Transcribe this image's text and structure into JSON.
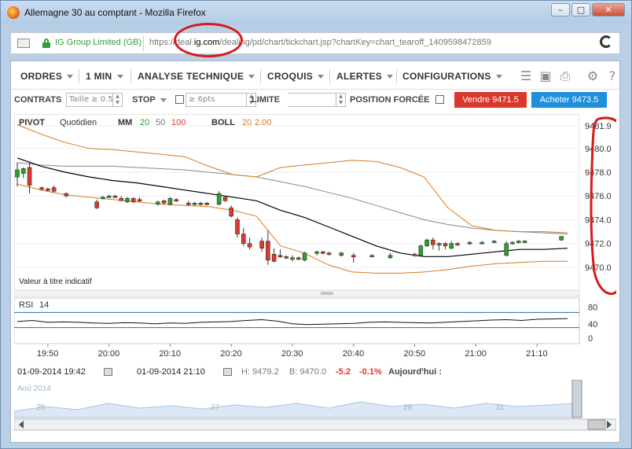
{
  "window": {
    "title": "Allemagne 30 au comptant - Mozilla Firefox",
    "buttons": [
      "–",
      "□",
      "✕"
    ]
  },
  "urlbar": {
    "site_identity": "IG Group Limited (GB)",
    "url_prefix": "https://deal.",
    "url_domain": "ig.com",
    "url_rest": "/dealing/pd/chart/tickchart.jsp?chartKey=chart_tearoff_1409598472859"
  },
  "menu": {
    "ordres": "ORDRES",
    "interval": "1 MIN",
    "analyse": "ANALYSE TECHNIQUE",
    "croquis": "CROQUIS",
    "alertes": "ALERTES",
    "configurations": "CONFIGURATIONS",
    "icons": [
      "layers-icon",
      "image-icon",
      "print-icon",
      "gear-icon",
      "help-icon"
    ]
  },
  "order": {
    "contrats_label": "CONTRATS",
    "contrats_placeholder": "Taille ≥ 0.5",
    "stop_label": "STOP",
    "stop_placeholder": "≥ 6pts",
    "limite_label": "LIMITE",
    "forcee_label": "POSITION FORCÉE",
    "sell": "Vendre 9471.5",
    "buy": "Acheter 9473.5"
  },
  "chart_data": {
    "type": "candlestick",
    "legend": {
      "pivot": "PIVOT",
      "pivot_period": "Quotidien",
      "mm": "MM",
      "mm_periods": [
        "20",
        "50",
        "100"
      ],
      "boll": "BOLL",
      "boll_params": [
        "20",
        "2.00"
      ]
    },
    "note": "Valeur à titre indicatif",
    "y_ticks": [
      "9481.9",
      "9480.0",
      "9478.0",
      "9476.0",
      "9474.0",
      "9472.0",
      "9470.0"
    ],
    "ylim": [
      9469.0,
      9482.5
    ],
    "x_ticks": [
      "19:50",
      "20:00",
      "20:10",
      "20:20",
      "20:30",
      "20:40",
      "20:50",
      "21:00",
      "21:10"
    ],
    "candles": [
      {
        "t": 0,
        "o": 9477.6,
        "h": 9478.8,
        "l": 9476.8,
        "c": 9478.2
      },
      {
        "t": 1,
        "o": 9477.9,
        "h": 9478.4,
        "l": 9477.5,
        "c": 9478.3
      },
      {
        "t": 2,
        "o": 9478.4,
        "h": 9478.9,
        "l": 9476.2,
        "c": 9476.9
      },
      {
        "t": 4,
        "o": 9476.7,
        "h": 9476.8,
        "l": 9476.5,
        "c": 9476.6
      },
      {
        "t": 5,
        "o": 9476.6,
        "h": 9476.7,
        "l": 9476.4,
        "c": 9476.5
      },
      {
        "t": 6,
        "o": 9476.7,
        "h": 9476.9,
        "l": 9476.3,
        "c": 9476.4
      },
      {
        "t": 8,
        "o": 9476.2,
        "h": 9476.3,
        "l": 9475.9,
        "c": 9476.0
      },
      {
        "t": 13,
        "o": 9475.5,
        "h": 9475.7,
        "l": 9474.9,
        "c": 9475.0
      },
      {
        "t": 14,
        "o": 9475.8,
        "h": 9476.0,
        "l": 9475.7,
        "c": 9475.9
      },
      {
        "t": 15,
        "o": 9476.0,
        "h": 9476.1,
        "l": 9475.9,
        "c": 9476.0
      },
      {
        "t": 16,
        "o": 9476.0,
        "h": 9476.1,
        "l": 9475.9,
        "c": 9475.9
      },
      {
        "t": 17,
        "o": 9475.8,
        "h": 9476.0,
        "l": 9475.6,
        "c": 9475.6
      },
      {
        "t": 18,
        "o": 9475.5,
        "h": 9475.9,
        "l": 9475.4,
        "c": 9475.8
      },
      {
        "t": 19,
        "o": 9475.8,
        "h": 9475.9,
        "l": 9475.4,
        "c": 9475.5
      },
      {
        "t": 20,
        "o": 9475.7,
        "h": 9475.9,
        "l": 9475.5,
        "c": 9475.6
      },
      {
        "t": 23,
        "o": 9475.3,
        "h": 9475.6,
        "l": 9475.2,
        "c": 9475.5
      },
      {
        "t": 24,
        "o": 9475.6,
        "h": 9475.7,
        "l": 9475.3,
        "c": 9475.4
      },
      {
        "t": 25,
        "o": 9475.3,
        "h": 9475.9,
        "l": 9475.2,
        "c": 9475.8
      },
      {
        "t": 26,
        "o": 9475.7,
        "h": 9475.8,
        "l": 9475.5,
        "c": 9475.6
      },
      {
        "t": 28,
        "o": 9475.4,
        "h": 9475.6,
        "l": 9475.2,
        "c": 9475.3
      },
      {
        "t": 29,
        "o": 9475.3,
        "h": 9475.5,
        "l": 9475.2,
        "c": 9475.4
      },
      {
        "t": 30,
        "o": 9475.3,
        "h": 9475.5,
        "l": 9475.2,
        "c": 9475.4
      },
      {
        "t": 31,
        "o": 9475.4,
        "h": 9475.5,
        "l": 9475.2,
        "c": 9475.3
      },
      {
        "t": 33,
        "o": 9475.3,
        "h": 9476.4,
        "l": 9475.2,
        "c": 9476.2
      },
      {
        "t": 34,
        "o": 9475.9,
        "h": 9476.0,
        "l": 9475.5,
        "c": 9475.6
      },
      {
        "t": 35,
        "o": 9475.0,
        "h": 9475.2,
        "l": 9474.2,
        "c": 9474.3
      },
      {
        "t": 36,
        "o": 9474.0,
        "h": 9474.2,
        "l": 9472.5,
        "c": 9472.8
      },
      {
        "t": 37,
        "o": 9472.8,
        "h": 9473.3,
        "l": 9471.8,
        "c": 9472.0
      },
      {
        "t": 38,
        "o": 9472.0,
        "h": 9472.5,
        "l": 9471.5,
        "c": 9471.7
      },
      {
        "t": 40,
        "o": 9472.2,
        "h": 9472.5,
        "l": 9471.3,
        "c": 9471.6
      },
      {
        "t": 41,
        "o": 9472.2,
        "h": 9473.1,
        "l": 9470.2,
        "c": 9470.6
      },
      {
        "t": 42,
        "o": 9471.1,
        "h": 9471.6,
        "l": 9470.4,
        "c": 9470.5
      },
      {
        "t": 43,
        "o": 9471.0,
        "h": 9471.5,
        "l": 9470.8,
        "c": 9470.9
      },
      {
        "t": 44,
        "o": 9470.9,
        "h": 9471.0,
        "l": 9470.7,
        "c": 9470.8
      },
      {
        "t": 45,
        "o": 9470.7,
        "h": 9471.0,
        "l": 9470.5,
        "c": 9470.8
      },
      {
        "t": 46,
        "o": 9470.8,
        "h": 9470.9,
        "l": 9470.6,
        "c": 9470.7
      },
      {
        "t": 47,
        "o": 9470.6,
        "h": 9471.3,
        "l": 9470.5,
        "c": 9471.2
      },
      {
        "t": 49,
        "o": 9471.2,
        "h": 9471.4,
        "l": 9471.0,
        "c": 9471.3
      },
      {
        "t": 50,
        "o": 9471.3,
        "h": 9471.4,
        "l": 9471.1,
        "c": 9471.2
      },
      {
        "t": 51,
        "o": 9471.2,
        "h": 9471.3,
        "l": 9471.0,
        "c": 9471.1
      },
      {
        "t": 53,
        "o": 9471.0,
        "h": 9471.3,
        "l": 9470.9,
        "c": 9471.2
      },
      {
        "t": 55,
        "o": 9471.0,
        "h": 9471.2,
        "l": 9470.4,
        "c": 9470.9
      },
      {
        "t": 58,
        "o": 9471.0,
        "h": 9471.1,
        "l": 9470.9,
        "c": 9471.0
      },
      {
        "t": 61,
        "o": 9470.8,
        "h": 9471.2,
        "l": 9470.7,
        "c": 9471.0
      },
      {
        "t": 65,
        "o": 9471.1,
        "h": 9471.2,
        "l": 9470.9,
        "c": 9471.0
      },
      {
        "t": 66,
        "o": 9471.0,
        "h": 9471.9,
        "l": 9470.9,
        "c": 9471.8
      },
      {
        "t": 67,
        "o": 9471.8,
        "h": 9472.4,
        "l": 9471.7,
        "c": 9472.3
      },
      {
        "t": 68,
        "o": 9472.3,
        "h": 9472.5,
        "l": 9471.5,
        "c": 9471.9
      },
      {
        "t": 69,
        "o": 9471.9,
        "h": 9472.1,
        "l": 9471.4,
        "c": 9472.0
      },
      {
        "t": 70,
        "o": 9472.0,
        "h": 9472.1,
        "l": 9471.5,
        "c": 9471.8
      },
      {
        "t": 71,
        "o": 9471.6,
        "h": 9472.2,
        "l": 9471.5,
        "c": 9472.0
      },
      {
        "t": 72,
        "o": 9472.0,
        "h": 9472.1,
        "l": 9471.8,
        "c": 9471.9
      },
      {
        "t": 74,
        "o": 9472.0,
        "h": 9472.2,
        "l": 9471.9,
        "c": 9472.1
      },
      {
        "t": 76,
        "o": 9472.1,
        "h": 9472.2,
        "l": 9472.0,
        "c": 9472.1
      },
      {
        "t": 78,
        "o": 9472.2,
        "h": 9472.3,
        "l": 9472.1,
        "c": 9472.2
      },
      {
        "t": 80,
        "o": 9471.0,
        "h": 9472.2,
        "l": 9470.9,
        "c": 9472.0
      },
      {
        "t": 81,
        "o": 9472.0,
        "h": 9472.2,
        "l": 9471.9,
        "c": 9472.1
      },
      {
        "t": 82,
        "o": 9472.1,
        "h": 9472.3,
        "l": 9472.0,
        "c": 9472.2
      },
      {
        "t": 83,
        "o": 9472.2,
        "h": 9472.3,
        "l": 9472.1,
        "c": 9472.2
      },
      {
        "t": 89,
        "o": 9472.3,
        "h": 9472.6,
        "l": 9472.2,
        "c": 9472.6
      }
    ],
    "boll_upper": [
      9482.0,
      9481.2,
      9480.5,
      9480.0,
      9479.9,
      9479.7,
      9479.5,
      9479.3,
      9478.5,
      9477.8,
      9477.6,
      9478.4,
      9478.6,
      9478.8,
      9479.0,
      9478.9,
      9478.4,
      9477.6,
      9475.0,
      9473.5,
      9473.1,
      9473.0,
      9473.0,
      9472.9
    ],
    "boll_lower": [
      9477.0,
      9476.5,
      9476.1,
      9475.9,
      9475.7,
      9475.5,
      9475.3,
      9475.2,
      9475.1,
      9474.8,
      9474.3,
      9471.8,
      9471.2,
      9470.2,
      9469.6,
      9469.5,
      9469.5,
      9469.6,
      9469.8,
      9470.1,
      9470.3,
      9470.4,
      9470.5,
      9470.5
    ],
    "boll_mid": [
      9479.2,
      9478.5,
      9478.0,
      9477.6,
      9477.3,
      9477.1,
      9476.8,
      9476.5,
      9476.2,
      9475.9,
      9475.6,
      9474.8,
      9474.2,
      9473.4,
      9472.6,
      9471.8,
      9471.2,
      9470.9,
      9470.9,
      9471.1,
      9471.3,
      9471.5,
      9471.5,
      9471.6
    ],
    "ma_long": [
      9478.8,
      9478.6,
      9478.5,
      9478.5,
      9478.5,
      9478.4,
      9478.3,
      9478.2,
      9478.0,
      9477.8,
      9477.6,
      9477.2,
      9476.8,
      9476.3,
      9475.8,
      9475.2,
      9474.6,
      9474.0,
      9473.6,
      9473.3,
      9473.1,
      9473.0,
      9472.9,
      9472.8
    ],
    "pivot_line_time_index": [
      0,
      89
    ],
    "annotation": {
      "rsi_label": "RSI",
      "rsi_period": "14",
      "rsi_ticks": [
        "80",
        "40",
        "0"
      ],
      "rsi_values": [
        46,
        49,
        44,
        45,
        44,
        42,
        41,
        43,
        42,
        40,
        42,
        41,
        44,
        45,
        46,
        49,
        51,
        47,
        40,
        38,
        39,
        40,
        41,
        44,
        45,
        44,
        43,
        42,
        44,
        46,
        48,
        50,
        51,
        49,
        52,
        53,
        54
      ]
    }
  },
  "status": {
    "from": "01-09-2014 19:42",
    "to": "01-09-2014 21:10",
    "high": "H: 9479.2",
    "low": "B: 9470.0",
    "change": "-5.2",
    "change_pct": "-0.1%",
    "today": "Aujourd'hui :"
  },
  "navigator": {
    "labels": [
      "Aoû 2014",
      "25",
      "27",
      "29",
      "31"
    ]
  },
  "colors": {
    "up": "#2e9e2e",
    "down": "#d93a2b",
    "boll": "#d77a22",
    "ma_short": "#000000",
    "ma_long": "#888888",
    "annotation_red": "#d81a1a",
    "sell": "#d9382b",
    "buy": "#1f8fdc"
  }
}
